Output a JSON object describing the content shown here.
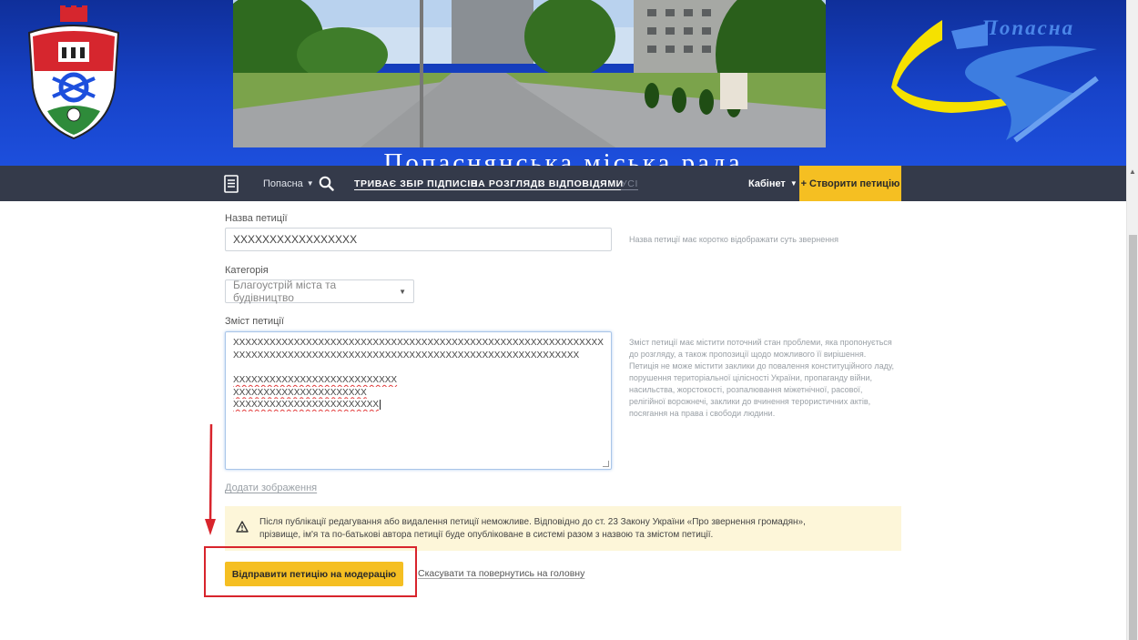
{
  "header": {
    "logo_text": "Попасна",
    "title": "Попаснянська міська рада"
  },
  "nav": {
    "city": "Попасна",
    "links": [
      "ТРИВАЄ ЗБІР ПІДПИСІВ",
      "НА РОЗГЛЯДІ",
      "З ВІДПОВІДЯМИ",
      "УСІ"
    ],
    "cabinet": "Кабінет",
    "create_button": "+ Створити петицію"
  },
  "form": {
    "title_label": "Назва петиції",
    "title_value": "XXXXXXXXXXXXXXXXX",
    "title_hint": "Назва петиції має коротко відображати суть звернення",
    "category_label": "Категорія",
    "category_value": "Благоустрій міста та будівництво",
    "content_label": "Зміст петиції",
    "content_lines": [
      "XXXXXXXXXXXXXXXXXXXXXXXXXXXXXXXXXXXXXXXXXXXXXXXXXXXXXXXXXXXXXXXXXXXX",
      "XXXXXXXXXXXXXXXXXXXXXXXXXXXXXXXXXXXXXXXXXXXXXXXXXXXXXXXXX",
      "XXXXXXXXXXXXXXXXXXXXXXXXXXX",
      "XXXXXXXXXXXXXXXXXXXXXX",
      "XXXXXXXXXXXXXXXXXXXXXXXX"
    ],
    "content_hint_lines": [
      "Зміст петиції має містити поточний стан проблеми, яка пропонується",
      "до розгляду, а також пропозиції щодо можливого її вирішення.",
      "Петиція не може містити заклики до повалення конституційного ладу,",
      "порушення територіальної цілісності України, пропаганду війни,",
      "насильства, жорстокості, розпалювання міжетнічної, расової,",
      "релігійної ворожнечі, заклики до вчинення терористичних актів,",
      "посягання на права і свободи людини."
    ],
    "add_image": "Додати зображення",
    "warning_lines": [
      "Після публікації редагування або видалення петиції неможливе. Відповідно до ст. 23 Закону України «Про звернення громадян»,",
      "прізвище, ім'я та по-батькові автора петиції буде опубліковане в системі разом з назвою та змістом петиції."
    ],
    "submit": "Відправити петицію на модерацію",
    "cancel": "Скасувати та повернутись на головну"
  },
  "colors": {
    "accent": "#f5bf22",
    "navbar": "#343a4a",
    "banner": "#1743c9",
    "highlight": "#d8242c",
    "warning_bg": "#fdf6d9"
  }
}
